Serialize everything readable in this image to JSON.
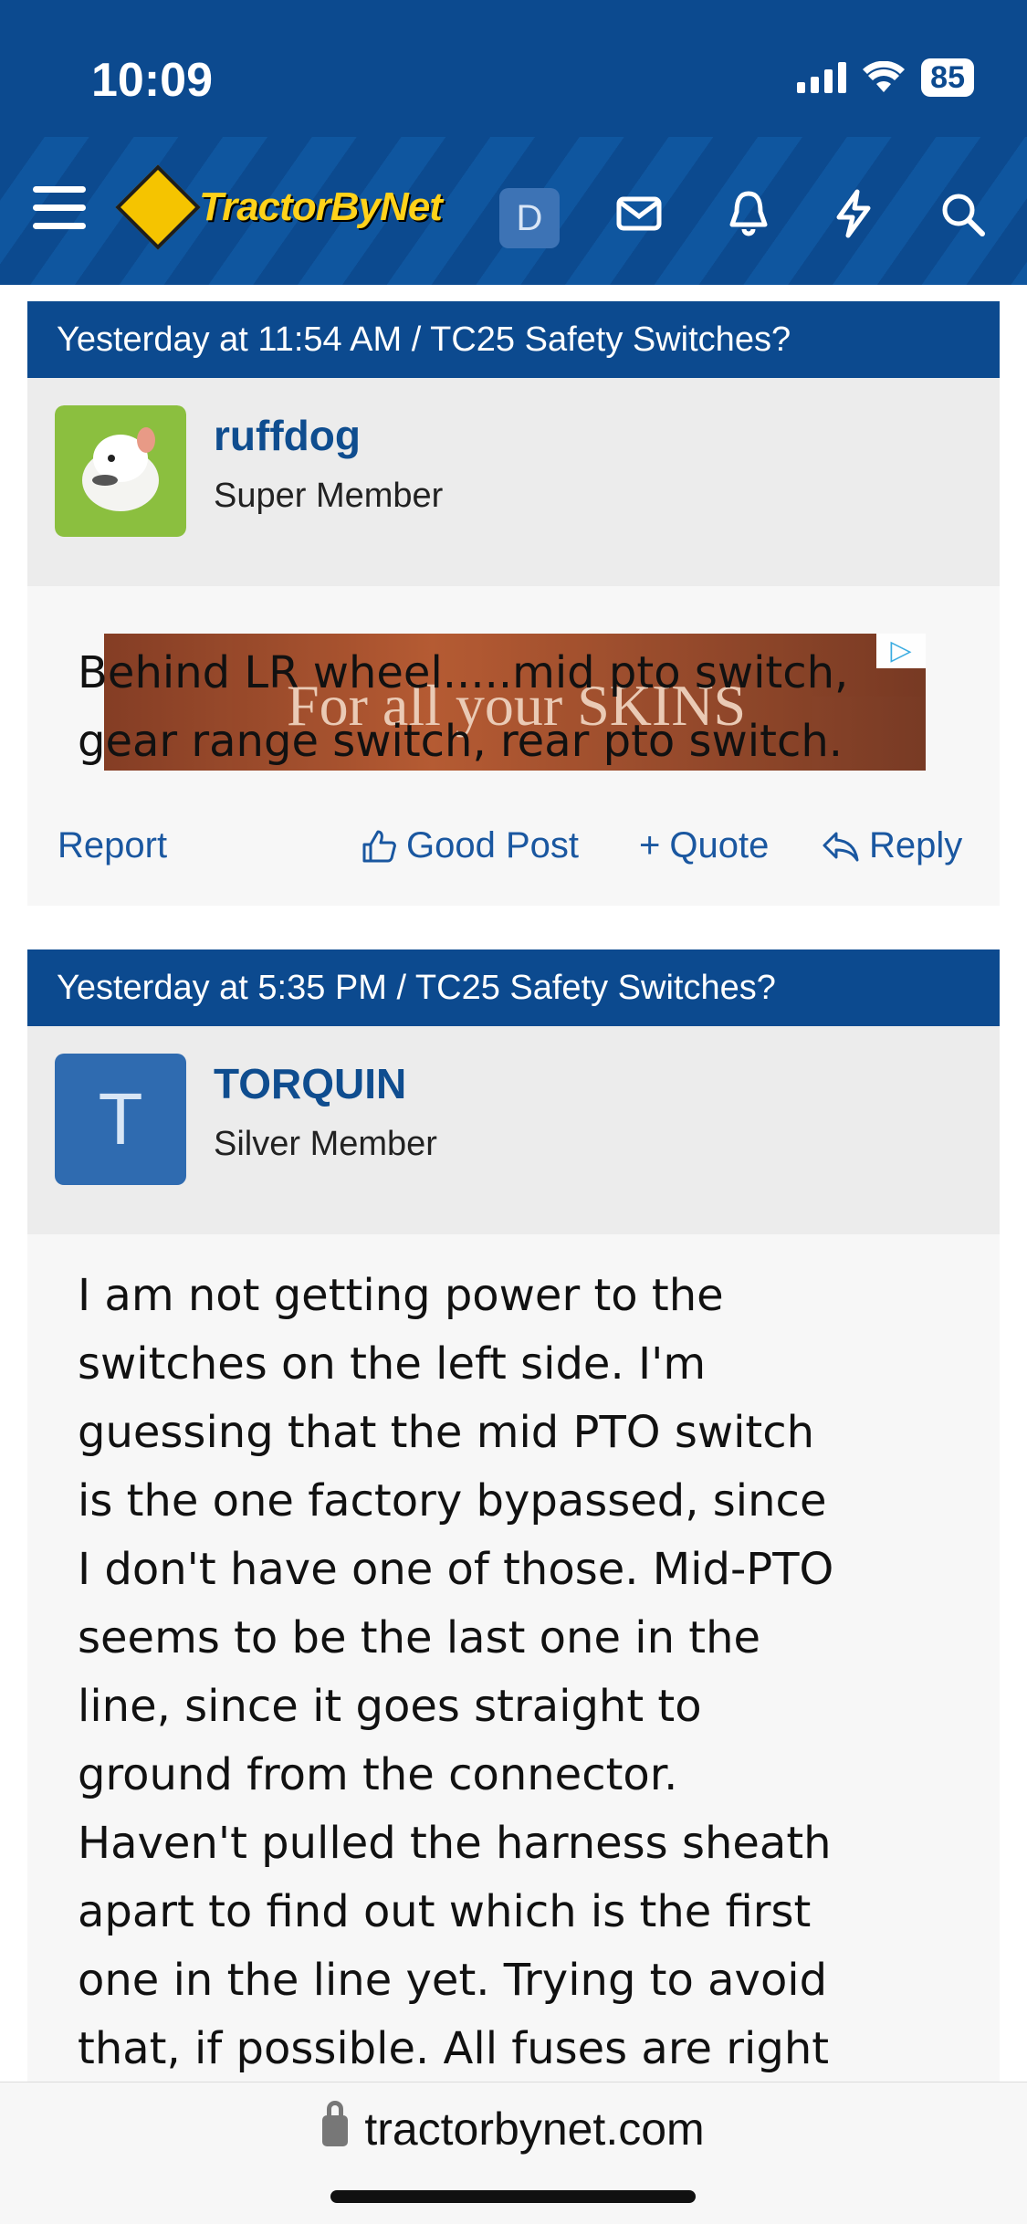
{
  "status_bar": {
    "time": "10:09",
    "battery": "85"
  },
  "header": {
    "logo_text": "TractorByNet",
    "user_initial": "D"
  },
  "posts": [
    {
      "meta": "Yesterday at 11:54 AM / TC25 Safety Switches?",
      "author": {
        "name": "ruffdog",
        "title": "Super Member"
      },
      "body_lines": [
        "Behind LR wheel.....mid pto switch,",
        "gear range switch, rear pto switch."
      ],
      "ad": {
        "text": "For all your SKINS"
      },
      "actions": {
        "report": "Report",
        "good_post": "Good Post",
        "quote": "Quote",
        "reply": "Reply"
      }
    },
    {
      "meta": "Yesterday at 5:35 PM / TC25 Safety Switches?",
      "author": {
        "name": "TORQUIN",
        "title": "Silver Member",
        "initial": "T"
      },
      "body_lines": [
        "I am not getting power to the",
        "switches on the left side. I'm",
        "guessing that the mid PTO switch",
        "is the one factory bypassed, since",
        "I don't have one of those. Mid-PTO",
        "seems to be the last one in the",
        "line, since it goes straight to",
        "ground from the connector.",
        "Haven't pulled the harness sheath",
        "apart to find out which is the first",
        "one in the line yet. Trying to avoid",
        "that, if possible. All fuses are right"
      ]
    }
  ],
  "browser": {
    "url": "tractorbynet.com"
  },
  "colors": {
    "brand_blue": "#0c4a8f",
    "link_blue": "#1a57a0",
    "logo_yellow": "#ffd21a"
  }
}
